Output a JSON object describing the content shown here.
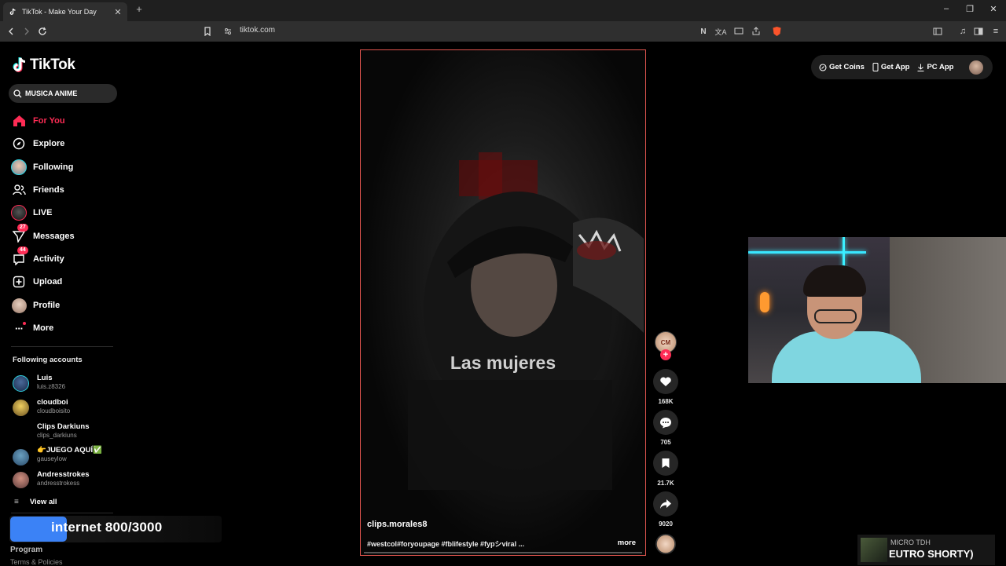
{
  "browser": {
    "tab_title": "TikTok - Make Your Day",
    "url": "tiktok.com"
  },
  "brand": {
    "name": "TikTok",
    "accent": "#fe2c55"
  },
  "search": {
    "value": "MUSICA ANIME"
  },
  "nav": [
    {
      "label": "For You",
      "icon": "home-icon",
      "active": true
    },
    {
      "label": "Explore",
      "icon": "compass-icon"
    },
    {
      "label": "Following",
      "icon": "following-avatar"
    },
    {
      "label": "Friends",
      "icon": "friends-icon"
    },
    {
      "label": "LIVE",
      "icon": "live-avatar"
    },
    {
      "label": "Messages",
      "icon": "messages-icon",
      "badge": "27"
    },
    {
      "label": "Activity",
      "icon": "activity-icon",
      "badge": "44"
    },
    {
      "label": "Upload",
      "icon": "upload-icon"
    },
    {
      "label": "Profile",
      "icon": "profile-avatar"
    },
    {
      "label": "More",
      "icon": "more-icon"
    }
  ],
  "following_accounts": {
    "title": "Following accounts",
    "accounts": [
      {
        "name": "Luis",
        "username": "luis.z8326"
      },
      {
        "name": "cloudboi",
        "username": "cloudboisito"
      },
      {
        "name": "Clips Darkiuns",
        "username": "clips_darkiuns"
      },
      {
        "name": "👉JUEGO AQUÍ✅",
        "username": "gauseylow"
      },
      {
        "name": "Andresstrokes",
        "username": "andresstrokess"
      }
    ],
    "view_all": "View all"
  },
  "overlay": {
    "text": "internet  800/3000"
  },
  "footer": {
    "program": "Program",
    "terms": "Terms & Policies"
  },
  "top_actions": {
    "get_coins": "Get Coins",
    "get_app": "Get App",
    "pc_app": "PC App"
  },
  "video": {
    "caption": "Las mujeres",
    "author": "clips.morales8",
    "hashtags": "#westcol#foryoupage #fblifestyle #fypシviral ...",
    "more": "more",
    "avatar_text": "CM"
  },
  "actions": {
    "likes": "168K",
    "comments": "705",
    "saves": "21.7K",
    "shares": "9020"
  },
  "now_playing": {
    "artist": "MICRO TDH",
    "title": "EUTRO SHORTY)"
  }
}
